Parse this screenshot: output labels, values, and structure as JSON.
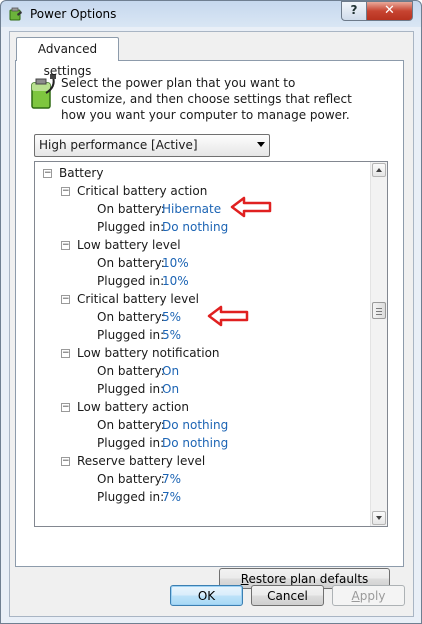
{
  "window": {
    "title": "Power Options",
    "help_label": "?",
    "close_label": "✕"
  },
  "tabs": [
    {
      "label": "Advanced settings"
    }
  ],
  "description": "Select the power plan that you want to customize, and then choose settings that reflect how you want your computer to manage power.",
  "plan_select": {
    "value": "High performance [Active]"
  },
  "tree": {
    "root": "Battery",
    "groups": [
      {
        "name": "Critical battery action",
        "on_battery_label": "On battery:",
        "on_battery": "Hibernate",
        "plugged_in_label": "Plugged in:",
        "plugged_in": "Do nothing"
      },
      {
        "name": "Low battery level",
        "on_battery_label": "On battery:",
        "on_battery": "10%",
        "plugged_in_label": "Plugged in:",
        "plugged_in": "10%"
      },
      {
        "name": "Critical battery level",
        "on_battery_label": "On battery:",
        "on_battery": "5%",
        "plugged_in_label": "Plugged in:",
        "plugged_in": "5%"
      },
      {
        "name": "Low battery notification",
        "on_battery_label": "On battery:",
        "on_battery": "On",
        "plugged_in_label": "Plugged in:",
        "plugged_in": "On"
      },
      {
        "name": "Low battery action",
        "on_battery_label": "On battery:",
        "on_battery": "Do nothing",
        "plugged_in_label": "Plugged in:",
        "plugged_in": "Do nothing"
      },
      {
        "name": "Reserve battery level",
        "on_battery_label": "On battery:",
        "on_battery": "7%",
        "plugged_in_label": "Plugged in:",
        "plugged_in": "7%"
      }
    ]
  },
  "buttons": {
    "restore": {
      "accel": "R",
      "rest": "estore plan defaults"
    },
    "ok": "OK",
    "cancel": "Cancel",
    "apply": {
      "accel": "A",
      "rest": "pply"
    }
  },
  "colors": {
    "link": "#1c64b4",
    "annotation_arrow": "#e02020"
  },
  "icons": {
    "window": "power-options-icon",
    "battery": "battery-plug-icon",
    "annotation": "red-arrow-icon"
  }
}
